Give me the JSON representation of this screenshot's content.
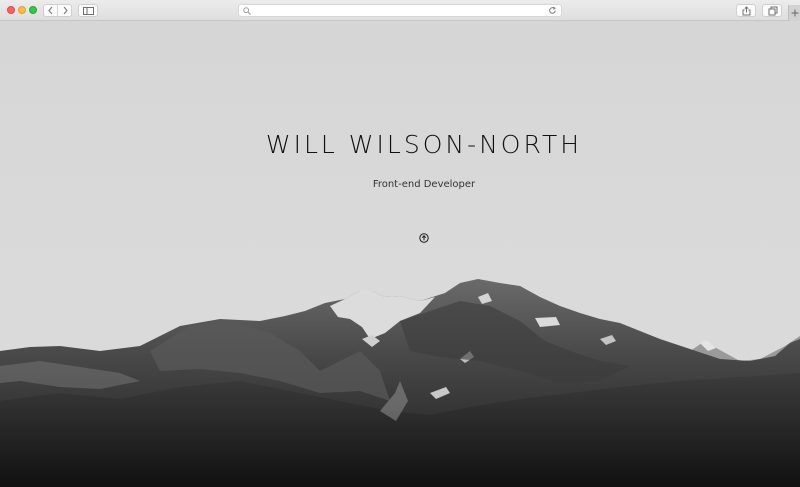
{
  "browser": {
    "address_placeholder": "",
    "icons": {
      "back": "chevron-left-icon",
      "forward": "chevron-right-icon",
      "sidebar": "sidebar-icon",
      "search": "search-icon",
      "reload": "reload-icon",
      "share": "share-icon",
      "tabs": "tabs-overview-icon",
      "new_tab": "plus-icon"
    },
    "traffic_lights": {
      "close": "#fc605c",
      "minimize": "#fdbc40",
      "zoom": "#34c84a"
    }
  },
  "hero": {
    "title": "WILL WILSON-NORTH",
    "subtitle": "Front-end Developer",
    "scroll_icon": "arrow-circle-icon",
    "background": "mountain-photo-grayscale"
  }
}
